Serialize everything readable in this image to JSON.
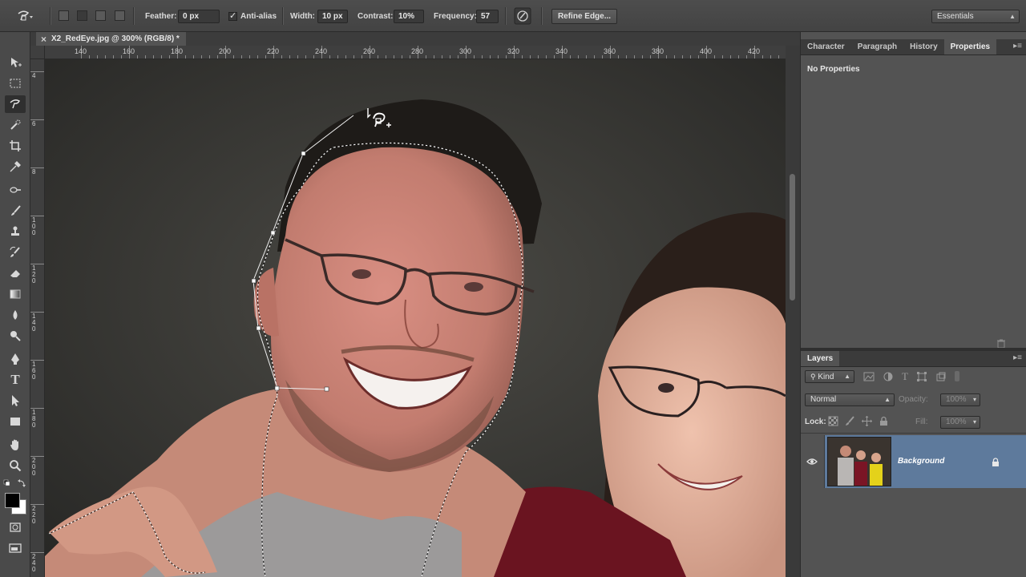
{
  "options": {
    "feather_label": "Feather:",
    "feather_value": "0 px",
    "antialias_label": "Anti-alias",
    "antialias_checked": true,
    "width_label": "Width:",
    "width_value": "10 px",
    "contrast_label": "Contrast:",
    "contrast_value": "10%",
    "frequency_label": "Frequency:",
    "frequency_value": "57",
    "refine_edge": "Refine Edge..."
  },
  "workspace": {
    "value": "Essentials"
  },
  "document": {
    "tab_title": "X2_RedEye.jpg @ 300% (RGB/8) *",
    "close_glyph": "×"
  },
  "ruler": {
    "top_labels": [
      "140",
      "160",
      "180",
      "200",
      "220",
      "240",
      "260",
      "280",
      "300",
      "320",
      "340",
      "360",
      "380",
      "400",
      "420"
    ],
    "left_labels": [
      "4",
      "6",
      "8",
      "100",
      "120",
      "140",
      "160",
      "180",
      "200",
      "220",
      "240"
    ]
  },
  "panels": {
    "upper_tabs": [
      "Character",
      "Paragraph",
      "History",
      "Properties"
    ],
    "upper_active": "Properties",
    "properties_text": "No Properties",
    "layers_tab": "Layers",
    "filter_kind": "Kind",
    "blend_mode": "Normal",
    "opacity_label": "Opacity:",
    "opacity_value": "100%",
    "lock_label": "Lock:",
    "fill_label": "Fill:",
    "fill_value": "100%",
    "layer_name": "Background"
  },
  "colors": {
    "ui_dark": "#535353",
    "layer_selected": "#5e7a9c",
    "selection_marquee": "#ffffff"
  },
  "icons": [
    "polygonal-lasso-icon",
    "move-icon",
    "marquee-icon",
    "quick-select-icon",
    "crop-icon",
    "eyedropper-icon",
    "healing-icon",
    "brush-icon",
    "stamp-icon",
    "history-brush-icon",
    "eraser-icon",
    "gradient-icon",
    "blur-icon",
    "dodge-icon",
    "pen-icon",
    "type-icon",
    "path-select-icon",
    "rectangle-icon",
    "hand-icon",
    "zoom-icon",
    "eye-icon",
    "lock-icon",
    "trash-icon"
  ]
}
